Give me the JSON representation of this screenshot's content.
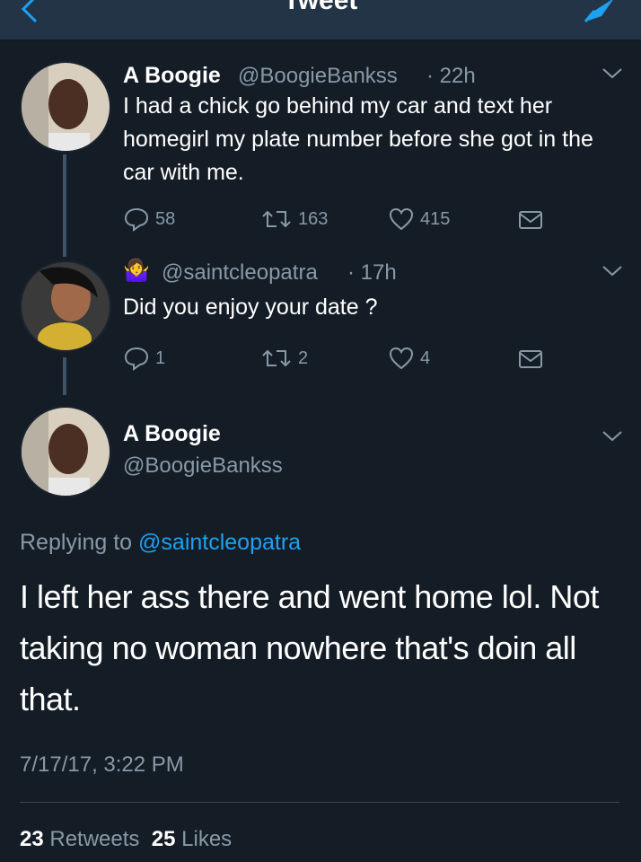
{
  "header": {
    "title": "Tweet"
  },
  "tweet1": {
    "name": "A Boogie",
    "handle": "@BoogieBankss",
    "time": "· 22h",
    "text": "I had a chick go behind my car and text her homegirl my plate number before she got in the car with me.",
    "replies": "58",
    "retweets": "163",
    "likes": "415"
  },
  "tweet2": {
    "emoji": "🤷‍♀️",
    "handle": "@saintcleopatra",
    "time": "· 17h",
    "text": "Did you enjoy your date ?",
    "replies": "1",
    "retweets": "2",
    "likes": "4"
  },
  "main": {
    "name": "A Boogie",
    "handle": "@BoogieBankss",
    "replying_label": "Replying to",
    "replying_to": "@saintcleopatra",
    "text": "I left her ass there and went home lol. Not taking no woman nowhere that's doin all that.",
    "timestamp": "7/17/17, 3:22 PM",
    "retweet_count": "23",
    "retweet_label": "Retweets",
    "like_count": "25",
    "like_label": "Likes"
  },
  "colors": {
    "background": "#141d26",
    "muted": "#8899a6",
    "accent": "#1da1f2"
  }
}
